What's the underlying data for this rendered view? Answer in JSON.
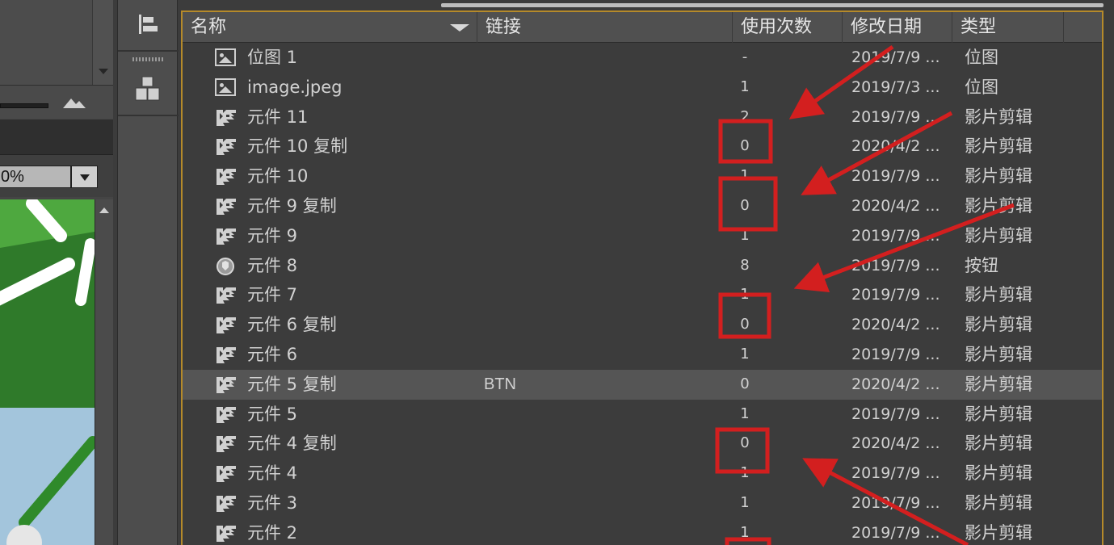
{
  "left_panel": {
    "zoom_value": "0%"
  },
  "library": {
    "columns": {
      "name": "名称",
      "link": "链接",
      "uses": "使用次数",
      "date": "修改日期",
      "type": "类型"
    },
    "rows": [
      {
        "icon": "bitmap-icon",
        "name": "位图 1",
        "link": "",
        "uses": "-",
        "date": "2019/7/9 ...",
        "type": "位图"
      },
      {
        "icon": "bitmap-icon",
        "name": "image.jpeg",
        "link": "",
        "uses": "1",
        "date": "2019/7/3 ...",
        "type": "位图"
      },
      {
        "icon": "movieclip-icon",
        "name": "元件 11",
        "link": "",
        "uses": "2",
        "date": "2019/7/9 ...",
        "type": "影片剪辑"
      },
      {
        "icon": "movieclip-icon",
        "name": "元件 10 复制",
        "link": "",
        "uses": "0",
        "date": "2020/4/2 ...",
        "type": "影片剪辑"
      },
      {
        "icon": "movieclip-icon",
        "name": "元件 10",
        "link": "",
        "uses": "1",
        "date": "2019/7/9 ...",
        "type": "影片剪辑"
      },
      {
        "icon": "movieclip-icon",
        "name": "元件 9 复制",
        "link": "",
        "uses": "0",
        "date": "2020/4/2 ...",
        "type": "影片剪辑"
      },
      {
        "icon": "movieclip-icon",
        "name": "元件 9",
        "link": "",
        "uses": "1",
        "date": "2019/7/9 ...",
        "type": "影片剪辑"
      },
      {
        "icon": "button-icon",
        "name": "元件 8",
        "link": "",
        "uses": "8",
        "date": "2019/7/9 ...",
        "type": "按钮"
      },
      {
        "icon": "movieclip-icon",
        "name": "元件 7",
        "link": "",
        "uses": "1",
        "date": "2019/7/9 ...",
        "type": "影片剪辑"
      },
      {
        "icon": "movieclip-icon",
        "name": "元件 6 复制",
        "link": "",
        "uses": "0",
        "date": "2020/4/2 ...",
        "type": "影片剪辑"
      },
      {
        "icon": "movieclip-icon",
        "name": "元件 6",
        "link": "",
        "uses": "1",
        "date": "2019/7/9 ...",
        "type": "影片剪辑"
      },
      {
        "icon": "movieclip-icon",
        "name": "元件 5 复制",
        "link": "BTN",
        "uses": "0",
        "date": "2020/4/2 ...",
        "type": "影片剪辑",
        "selected": true
      },
      {
        "icon": "movieclip-icon",
        "name": "元件 5",
        "link": "",
        "uses": "1",
        "date": "2019/7/9 ...",
        "type": "影片剪辑"
      },
      {
        "icon": "movieclip-icon",
        "name": "元件 4 复制",
        "link": "",
        "uses": "0",
        "date": "2020/4/2 ...",
        "type": "影片剪辑"
      },
      {
        "icon": "movieclip-icon",
        "name": "元件 4",
        "link": "",
        "uses": "1",
        "date": "2019/7/9 ...",
        "type": "影片剪辑"
      },
      {
        "icon": "movieclip-icon",
        "name": "元件 3",
        "link": "",
        "uses": "1",
        "date": "2019/7/9 ...",
        "type": "影片剪辑"
      },
      {
        "icon": "movieclip-icon",
        "name": "元件 2",
        "link": "",
        "uses": "1",
        "date": "2019/7/9 ...",
        "type": "影片剪辑"
      }
    ]
  },
  "colors": {
    "annotation_red": "#d31f1f",
    "panel_focus_border": "#b58a2a",
    "stage_green": "#3f9a35",
    "stage_sky": "#a3c5dc"
  }
}
